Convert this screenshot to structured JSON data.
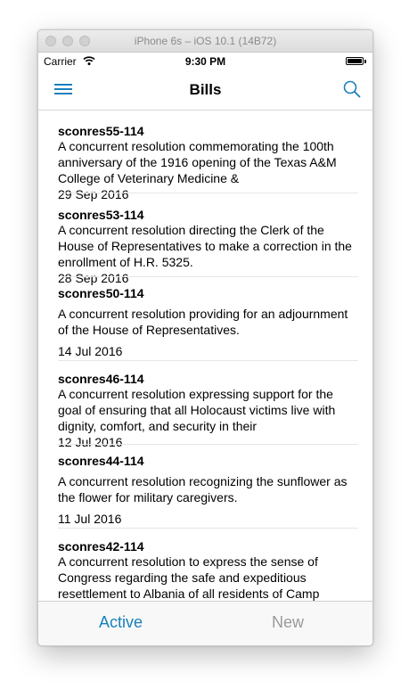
{
  "simulator": {
    "title": "iPhone 6s – iOS 10.1 (14B72)"
  },
  "status_bar": {
    "carrier": "Carrier",
    "time": "9:30 PM"
  },
  "nav": {
    "title": "Bills"
  },
  "bills": [
    {
      "id": "sconres55-114",
      "title": "A concurrent resolution commemorating the 100th anniversary of the 1916 opening of the Texas A&M College of Veterinary Medicine &",
      "date": "29 Sep 2016"
    },
    {
      "id": "sconres53-114",
      "title": "A concurrent resolution directing the Clerk of the House of Representatives to make a correction in the enrollment of H.R. 5325.",
      "date": "28 Sep 2016"
    },
    {
      "id": "sconres50-114",
      "title": "A concurrent resolution providing for an adjournment of the House of Representatives.",
      "date": "14 Jul 2016"
    },
    {
      "id": "sconres46-114",
      "title": "A concurrent resolution expressing support for the goal of ensuring that all Holocaust victims live with dignity, comfort, and security in their",
      "date": "12 Jul 2016"
    },
    {
      "id": "sconres44-114",
      "title": "A concurrent resolution recognizing the sunflower as the flower for military caregivers.",
      "date": "11 Jul 2016"
    },
    {
      "id": "sconres42-114",
      "title": "A concurrent resolution to express the sense of Congress regarding the safe and expeditious resettlement to Albania of all residents of Camp",
      "date": ""
    }
  ],
  "tabs": {
    "active": "Active",
    "new": "New"
  },
  "colors": {
    "accent": "#1a80bc",
    "inactive_tab": "#9a9a9a"
  },
  "icons": {
    "menu": "hamburger-menu-icon",
    "search": "search-icon",
    "wifi": "wifi-icon",
    "battery": "battery-icon"
  }
}
